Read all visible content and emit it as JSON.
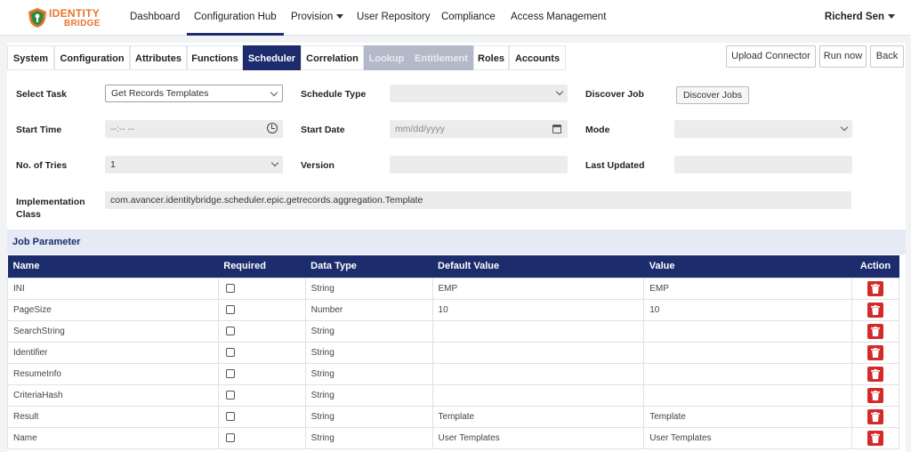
{
  "brand": {
    "line1": "IDENTITY",
    "line2": "BRIDGE"
  },
  "nav": {
    "items": [
      {
        "label": "Dashboard"
      },
      {
        "label": "Configuration Hub"
      },
      {
        "label": "Provision"
      },
      {
        "label": "User Repository"
      },
      {
        "label": "Compliance"
      },
      {
        "label": "Access Management"
      }
    ],
    "user": "Richerd Sen"
  },
  "tabs": [
    {
      "label": "System",
      "state": "normal"
    },
    {
      "label": "Configuration",
      "state": "normal"
    },
    {
      "label": "Attributes",
      "state": "normal"
    },
    {
      "label": "Functions",
      "state": "normal"
    },
    {
      "label": "Scheduler",
      "state": "active"
    },
    {
      "label": "Correlation",
      "state": "normal"
    },
    {
      "label": "Lookup",
      "state": "disabled"
    },
    {
      "label": "Entitlement",
      "state": "disabled"
    },
    {
      "label": "Roles",
      "state": "normal"
    },
    {
      "label": "Accounts",
      "state": "normal"
    }
  ],
  "actions": {
    "upload": "Upload Connector",
    "run": "Run now",
    "back": "Back"
  },
  "form": {
    "select_task": {
      "label": "Select Task",
      "value": "Get Records Templates"
    },
    "schedule_type": {
      "label": "Schedule Type",
      "value": ""
    },
    "discover_job": {
      "label": "Discover Job",
      "button": "Discover Jobs"
    },
    "start_time": {
      "label": "Start Time",
      "value": "--:-- --"
    },
    "start_date": {
      "label": "Start Date",
      "value": "mm/dd/yyyy"
    },
    "mode": {
      "label": "Mode",
      "value": ""
    },
    "tries": {
      "label": "No. of Tries",
      "value": "1"
    },
    "version": {
      "label": "Version",
      "value": ""
    },
    "last_updated": {
      "label": "Last Updated",
      "value": ""
    },
    "impl_class": {
      "label_line1": "Implementation",
      "label_line2": "Class",
      "value": "com.avancer.identitybridge.scheduler.epic.getrecords.aggregation.Template"
    }
  },
  "job_parameter": {
    "title": "Job Parameter",
    "columns": {
      "name": "Name",
      "required": "Required",
      "data_type": "Data Type",
      "default_value": "Default Value",
      "value": "Value",
      "action": "Action"
    },
    "rows": [
      {
        "name": "INI",
        "data_type": "String",
        "default_value": "EMP",
        "value": "EMP"
      },
      {
        "name": "PageSize",
        "data_type": "Number",
        "default_value": "10",
        "value": "10"
      },
      {
        "name": "SearchString",
        "data_type": "String",
        "default_value": "",
        "value": ""
      },
      {
        "name": "Identifier",
        "data_type": "String",
        "default_value": "",
        "value": ""
      },
      {
        "name": "ResumeInfo",
        "data_type": "String",
        "default_value": "",
        "value": ""
      },
      {
        "name": "CriteriaHash",
        "data_type": "String",
        "default_value": "",
        "value": ""
      },
      {
        "name": "Result",
        "data_type": "String",
        "default_value": "Template",
        "value": "Template"
      },
      {
        "name": "Name",
        "data_type": "String",
        "default_value": "User Templates",
        "value": "User Templates"
      }
    ]
  },
  "colors": {
    "navy": "#1c2c6c",
    "brand_orange": "#e8742a",
    "danger": "#d32a2a",
    "disabled_tab": "#b3b9c8"
  }
}
